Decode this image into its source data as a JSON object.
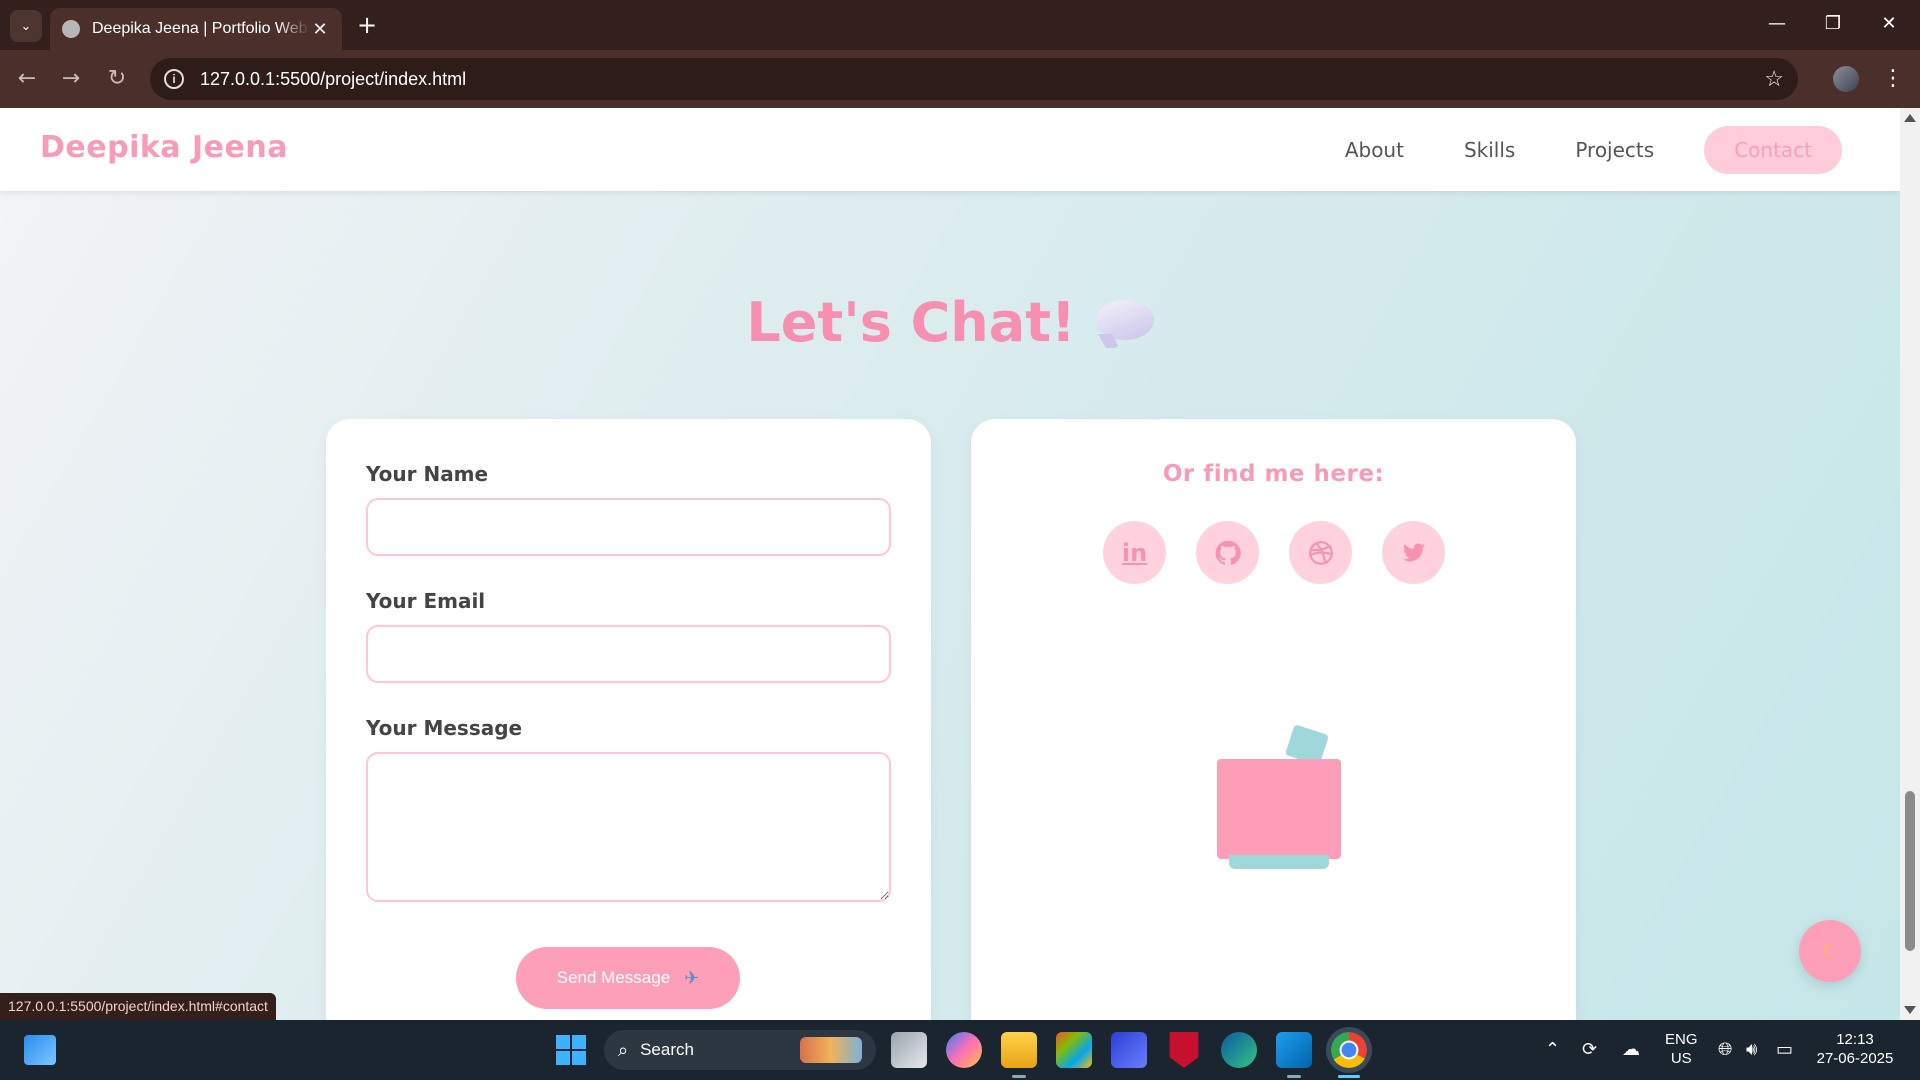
{
  "browser": {
    "tab_title": "Deepika Jeena | Portfolio Website",
    "url": "127.0.0.1:5500/project/index.html",
    "status_url": "127.0.0.1:5500/project/index.html#contact"
  },
  "site": {
    "logo": "Deepika Jeena",
    "nav": [
      {
        "label": "About"
      },
      {
        "label": "Skills"
      },
      {
        "label": "Projects"
      },
      {
        "label": "Contact",
        "active": true
      }
    ]
  },
  "contact": {
    "title": "Let's Chat!",
    "form": {
      "name_label": "Your Name",
      "email_label": "Your Email",
      "message_label": "Your Message",
      "submit_label": "Send Message"
    },
    "find_me": {
      "title": "Or find me here:",
      "socials": [
        "linkedin-icon",
        "github-icon",
        "dribbble-icon",
        "twitter-icon"
      ]
    }
  },
  "taskbar": {
    "search_label": "Search",
    "language": "ENG",
    "region": "US",
    "time": "12:13",
    "date": "27-06-2025"
  },
  "colors": {
    "accent_pink": "#f78fb0",
    "soft_pink": "#ffd2de",
    "teal": "#9fd8da",
    "browser_chrome": "#4a2f2a"
  }
}
